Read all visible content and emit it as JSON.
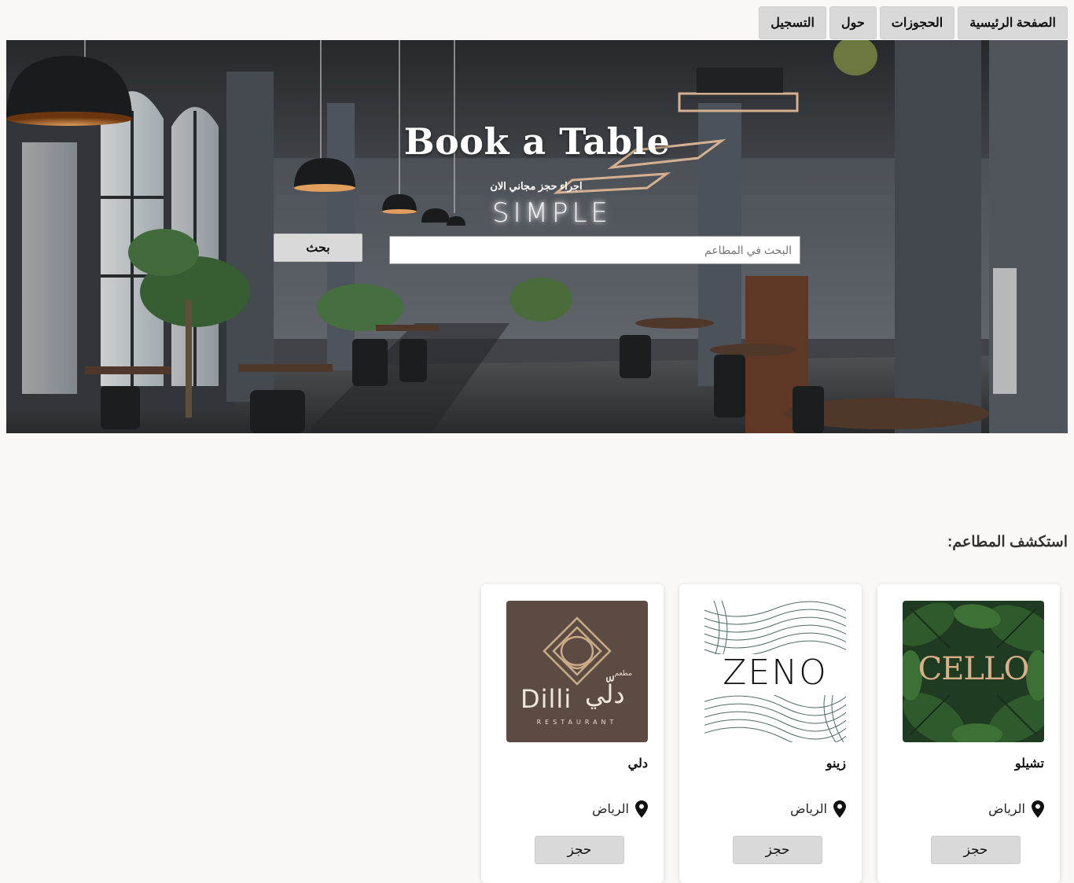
{
  "nav": {
    "items": [
      {
        "label": "الصفحة الرئيسية"
      },
      {
        "label": "الحجوزات"
      },
      {
        "label": "حول"
      },
      {
        "label": "التسجيل"
      }
    ]
  },
  "hero": {
    "title": "Book a Table",
    "subtitle": "اجراء حجز مجاني الان",
    "sign_text": "SIMPLE",
    "search": {
      "placeholder": "البحث في المطاعم",
      "value": "",
      "button_label": "بحث"
    }
  },
  "section": {
    "title": "استكشف المطاعم:"
  },
  "restaurants": [
    {
      "name": "تشيلو",
      "city": "الرياض",
      "book_label": "حجز",
      "logo_text": "CELLO",
      "logo_icon": "cello-logo"
    },
    {
      "name": "زينو",
      "city": "الرياض",
      "book_label": "حجز",
      "logo_text": "ZENO",
      "logo_icon": "zeno-logo"
    },
    {
      "name": "دلي",
      "city": "الرياض",
      "book_label": "حجز",
      "logo_text": "Dilli",
      "logo_text_ar": "دلّي",
      "logo_subtitle": "RESTAURANT",
      "logo_small_ar": "مطعم",
      "logo_icon": "dilli-logo"
    }
  ],
  "colors": {
    "page_bg": "#f9f8f6",
    "button_bg": "#d9d9d9",
    "dilli_brand": "#5c4b43",
    "dilli_gold": "#c9ab87",
    "cello_gold": "#d6b088",
    "zeno_line": "#4d6b66"
  }
}
